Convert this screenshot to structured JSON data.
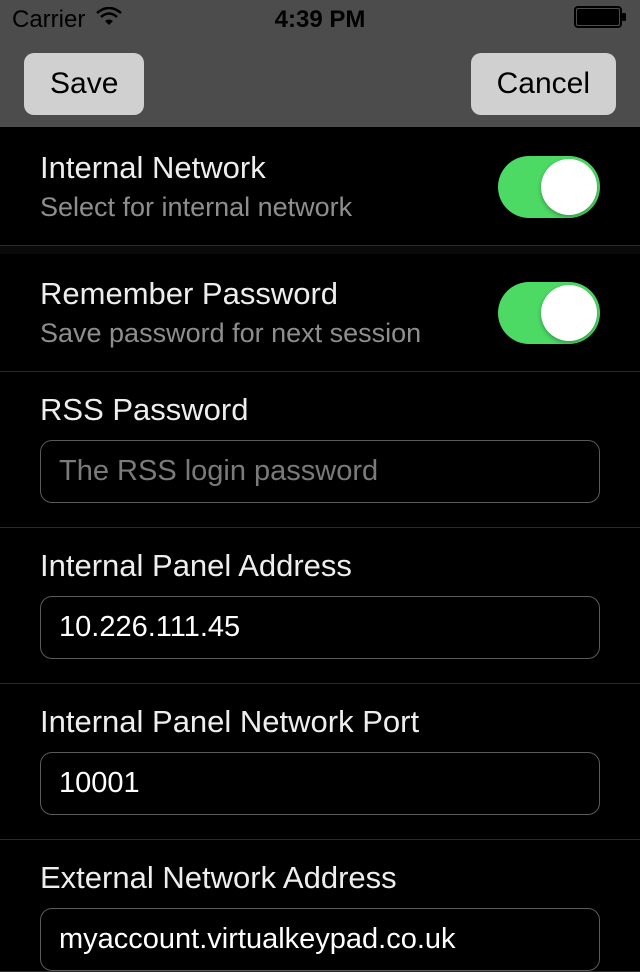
{
  "status": {
    "carrier": "Carrier",
    "time": "4:39 PM"
  },
  "nav": {
    "save_label": "Save",
    "cancel_label": "Cancel"
  },
  "settings": {
    "internal_network": {
      "title": "Internal Network",
      "subtitle": "Select for internal network",
      "enabled": true
    },
    "remember_password": {
      "title": "Remember Password",
      "subtitle": "Save password for next session",
      "enabled": true
    },
    "rss_password": {
      "label": "RSS Password",
      "placeholder": "The RSS login password",
      "value": ""
    },
    "internal_panel_address": {
      "label": "Internal Panel Address",
      "value": "10.226.111.45"
    },
    "internal_panel_port": {
      "label": "Internal Panel Network Port",
      "value": "10001"
    },
    "external_network_address": {
      "label": "External Network Address",
      "value": "myaccount.virtualkeypad.co.uk"
    }
  },
  "colors": {
    "toggle_on": "#4cd964",
    "background": "#000000",
    "text_primary": "#eeeeee",
    "text_secondary": "#8e8e8e"
  }
}
